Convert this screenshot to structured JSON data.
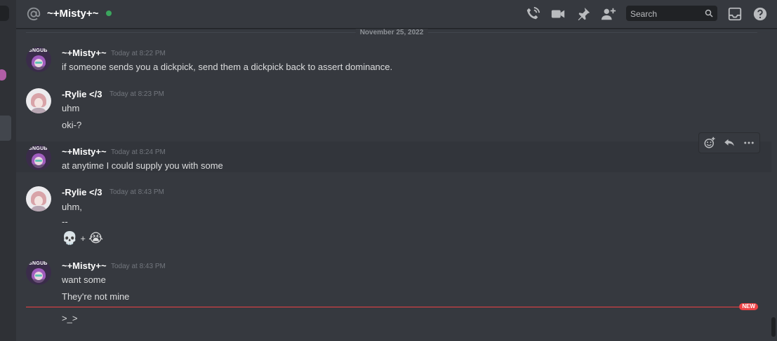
{
  "header": {
    "channel_name": "~+Misty+~",
    "status_color": "#3ba55d",
    "icons": [
      "at-icon",
      "voice-call-icon",
      "video-call-icon",
      "pinned-messages-icon",
      "add-friend-icon",
      "inbox-icon",
      "help-icon"
    ],
    "search_placeholder": "Search"
  },
  "date_divider": "November 25, 2022",
  "messages": [
    {
      "author": "~+Misty+~",
      "time": "Today at 8:22 PM",
      "lines": [
        "if someone sends you a dickpick, send them a dickpick back to assert dominance."
      ]
    },
    {
      "author": "-Rylie </3",
      "time": "Today at 8:23 PM",
      "lines": [
        "uhm",
        "oki-?"
      ]
    },
    {
      "author": "~+Misty+~",
      "time": "Today at 8:24 PM",
      "lines": [
        "at anytime I could supply you with some"
      ]
    },
    {
      "author": "-Rylie </3",
      "time": "Today at 8:43 PM",
      "lines": [
        "uhm,",
        "--"
      ],
      "emoji_line": {
        "first": "💀",
        "sep": "+",
        "second": "😭"
      }
    },
    {
      "author": "~+Misty+~",
      "time": "Today at 8:43 PM",
      "lines": [
        "want some",
        "They're not mine"
      ]
    }
  ],
  "avatar_text": "SNGUB",
  "new_badge": "NEW",
  "pending_line": ">_>",
  "message_toolbar": [
    "add-reaction-icon",
    "reply-icon",
    "more-icon"
  ]
}
